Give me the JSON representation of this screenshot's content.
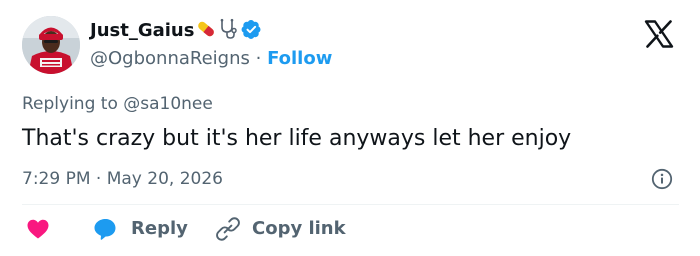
{
  "author": {
    "display_name": "Just_Gaius",
    "handle": "@OgbonnaReigns",
    "separator": "·",
    "follow_label": "Follow",
    "name_emojis": [
      "pill-emoji",
      "stethoscope-emoji"
    ],
    "verified": true
  },
  "tweet": {
    "replying_prefix": "Replying to",
    "replying_handle": "@sa10nee",
    "text": "That's crazy but it's her life anyways let her enjoy",
    "time": "7:29 PM",
    "date_separator": "·",
    "date": "May 20, 2026"
  },
  "actions": {
    "reply_label": "Reply",
    "copy_link_label": "Copy link"
  },
  "icons": {
    "brand": "x-logo-icon",
    "info": "info-icon",
    "like": "heart-icon",
    "reply": "speech-bubble-icon",
    "copy": "link-icon"
  },
  "colors": {
    "accent": "#1d9bf0",
    "like": "#f91880",
    "text_primary": "#0f1419",
    "text_secondary": "#536471",
    "divider": "#eff3f4"
  }
}
